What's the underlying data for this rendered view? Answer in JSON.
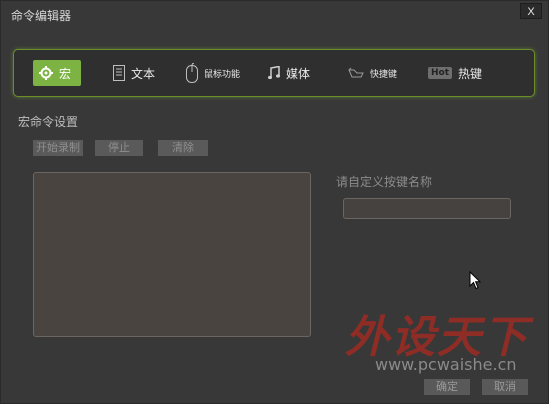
{
  "window": {
    "title": "命令编辑器",
    "close_label": "X"
  },
  "toolbar": {
    "items": [
      {
        "label": "宏",
        "icon": "gear-icon",
        "active": true
      },
      {
        "label": "文本",
        "icon": "document-icon"
      },
      {
        "label": "鼠标功能",
        "icon": "mouse-icon"
      },
      {
        "label": "媒体",
        "icon": "music-note-icon"
      },
      {
        "label": "快捷键",
        "icon": "shortcut-icon"
      },
      {
        "label": "热键",
        "icon": "hot-badge-icon",
        "badge": "Hot"
      }
    ]
  },
  "macro": {
    "section_title": "宏命令设置",
    "buttons": {
      "record": "开始录制",
      "stop": "停止",
      "clear": "清除"
    }
  },
  "key_name": {
    "label": "请自定义按键名称",
    "value": ""
  },
  "footer": {
    "ok": "确定",
    "cancel": "取消"
  },
  "watermark": {
    "text": "外设天下",
    "url": "www.pcwaishe.cn"
  },
  "colors": {
    "accent": "#7cb342",
    "toolbar_border": "#6a8f2a",
    "watermark": "#9e2a23",
    "background": "#383838"
  }
}
